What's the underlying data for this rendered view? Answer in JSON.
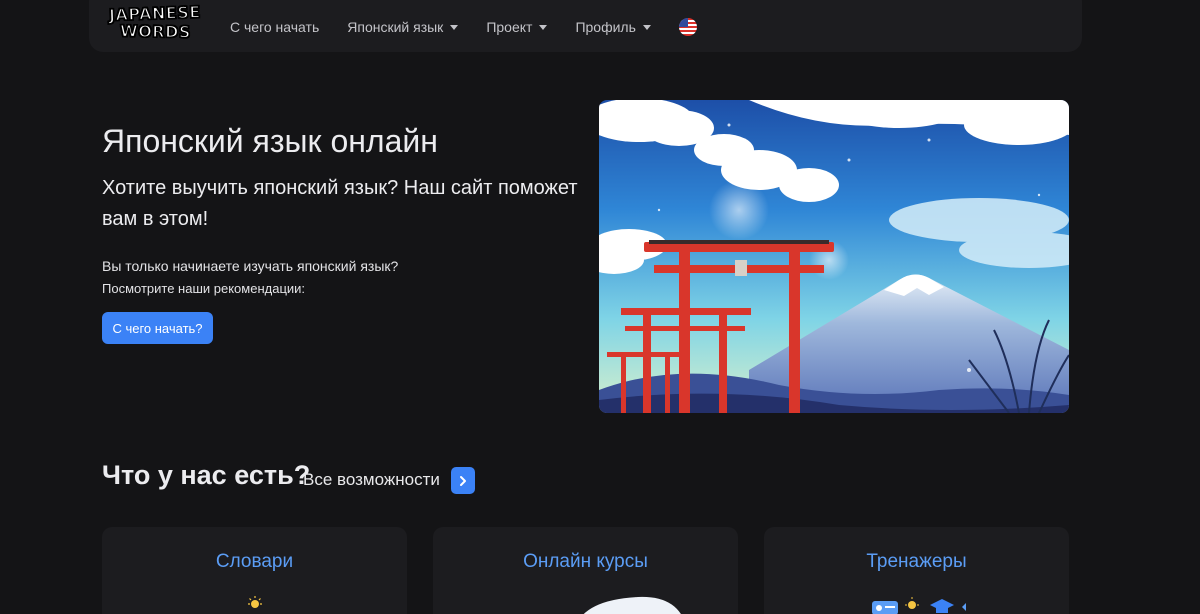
{
  "logo": {
    "line1": "JAPANESE",
    "line2": "WORDS"
  },
  "nav": {
    "items": [
      {
        "label": "С чего начать",
        "has_dropdown": false
      },
      {
        "label": "Японский язык",
        "has_dropdown": true
      },
      {
        "label": "Проект",
        "has_dropdown": true
      },
      {
        "label": "Профиль",
        "has_dropdown": true
      }
    ],
    "language_icon": "us-flag-icon"
  },
  "hero": {
    "title": "Японский язык онлайн",
    "subtitle": "Хотите выучить японский язык? Наш сайт поможет вам в этом!",
    "text1": "Вы только начинаете изучать японский язык?",
    "text2": "Посмотрите наши рекомендации:",
    "button_label": "С чего начать?"
  },
  "features": {
    "title": "Что у нас есть?",
    "all_link": "Все возможности",
    "cards": [
      {
        "title": "Словари",
        "icon": "lightbulb-icon"
      },
      {
        "title": "Онлайн курсы",
        "icon": "course-icon"
      },
      {
        "title": "Тренажеры",
        "icon": "trainer-icon"
      }
    ]
  },
  "colors": {
    "background": "#141416",
    "navbar": "#1c1c1f",
    "accent": "#3b82f6",
    "card_title": "#5b9df5"
  }
}
